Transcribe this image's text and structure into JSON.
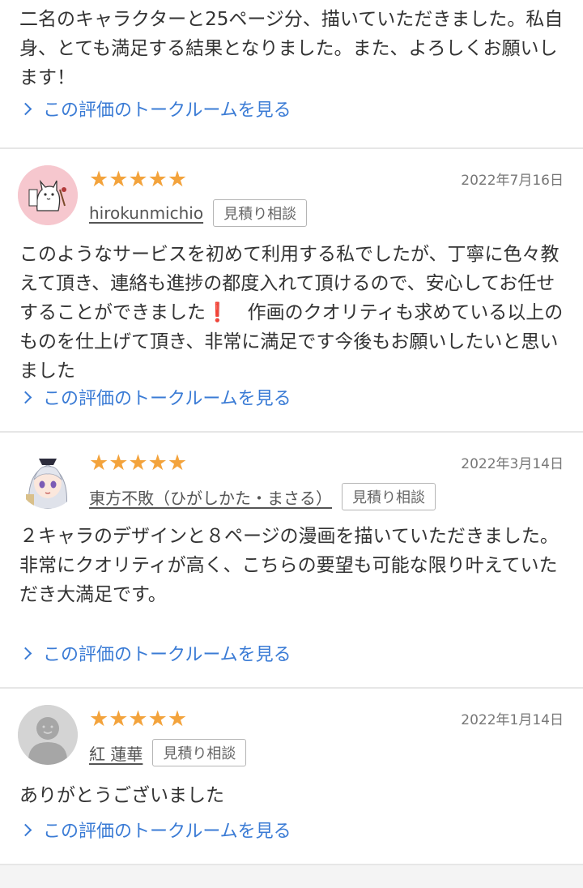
{
  "colors": {
    "star": "#f3a33c",
    "link": "#3a7bd5",
    "divider": "#e6e6e6"
  },
  "first_review": {
    "body": "二名のキャラクターと25ページ分、描いていただきました。私自身、とても満足する結果となりました。また、よろしくお願いします！",
    "link": "この評価のトークルームを見る"
  },
  "reviews": [
    {
      "stars": "★★★★★",
      "date": "2022年7月16日",
      "username": "hirokunmichio",
      "badge": "見積り相談",
      "body": "このようなサービスを初めて利用する私でしたが、丁寧に色々教えて頂き、連絡も進捗の都度入れて頂けるので、安心してお任せすることができました❗　作画のクオリティも求めている以上のものを仕上げて頂き、非常に満足です今後もお願いしたいと思いました",
      "link": "この評価のトークルームを見る",
      "avatar_icon": "cat-character-avatar"
    },
    {
      "stars": "★★★★★",
      "date": "2022年3月14日",
      "username": "東方不敗（ひがしかた・まさる）",
      "badge": "見積り相談",
      "body": "２キャラのデザインと８ページの漫画を描いていただきました。\n非常にクオリティが高く、こちらの要望も可能な限り叶えていただき大満足です。",
      "link": "この評価のトークルームを見る",
      "avatar_icon": "anime-girl-avatar"
    },
    {
      "stars": "★★★★★",
      "date": "2022年1月14日",
      "username": "紅 蓮華",
      "badge": "見積り相談",
      "body": "ありがとうございました",
      "link": "この評価のトークルームを見る",
      "avatar_icon": "default-user-avatar"
    }
  ]
}
